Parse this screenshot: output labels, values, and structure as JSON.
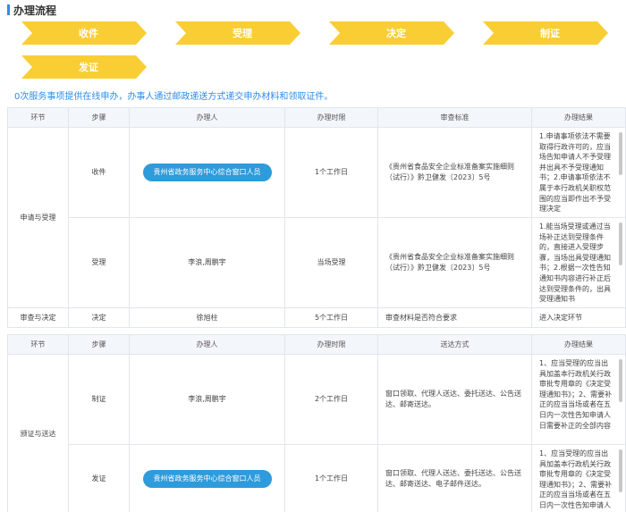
{
  "section_title": "办理流程",
  "flow_steps": [
    "收件",
    "受理",
    "决定",
    "制证",
    "发证"
  ],
  "notice": "0次服务事项提供在线申办，办事人通过邮政递送方式递交申办材料和领取证件。",
  "table1": {
    "headers": [
      "环节",
      "步骤",
      "办理人",
      "办理时限",
      "审查标准",
      "办理结果"
    ],
    "stage1": "申请与受理",
    "rows": [
      {
        "step": "收件",
        "handler": "贵州省政务服务中心综合窗口人员",
        "time": "1个工作日",
        "standard": "《贵州省食品安全企业标准备案实施细则（试行）》黔卫健发〔2023〕5号",
        "result": "1.申请事项依法不需要取得行政许可的，应当场告知申请人不予受理并出具不予受理通知书；2.申请事项依法不属于本行政机关职权范围的应当即作出不予受理决定"
      },
      {
        "step": "受理",
        "handler": "李浪,周鹏宇",
        "time": "当场受理",
        "standard": "《贵州省食品安全企业标准备案实施细则（试行）》黔卫健发〔2023〕5号",
        "result": "1.能当场受理或通过当场补正达到受理条件的，直接进入受理步骤，当场出具受理通知书；2.根据一次性告知通知书内容进行补正后达到受理条件的，出具受理通知书"
      }
    ],
    "stage2": "审查与决定",
    "row3": {
      "step": "决定",
      "handler": "徐旭柱",
      "time": "5个工作日",
      "standard": "审查材料是否符合要求",
      "result": "进入决定环节"
    }
  },
  "table2": {
    "headers": [
      "环节",
      "步骤",
      "办理人",
      "办理时限",
      "送达方式",
      "办理结果"
    ],
    "stage": "颁证与送达",
    "rows": [
      {
        "step": "制证",
        "handler": "李浪,周鹏宇",
        "time": "2个工作日",
        "delivery": "窗口领取、代理人送达、委托送达、公告送达、邮寄送达。",
        "result": "1、应当受理的应当出具加盖本行政机关行政审批专用章的《决定受理通知书》；2、需要补正的应当当场或者在五日内一次性告知申请人日需要补正的全部内容"
      },
      {
        "step": "发证",
        "handler": "贵州省政务服务中心综合窗口人员",
        "time": "1个工作日",
        "delivery": "窗口领取、代理人送达、委托送达、公告送达、邮寄送达、电子邮件送达。",
        "result": "1、应当受理的应当出具加盖本行政机关行政审批专用章的《决定受理通知书》；2、需要补正的应当当场或者在五日内一次性告知申请人"
      }
    ]
  }
}
